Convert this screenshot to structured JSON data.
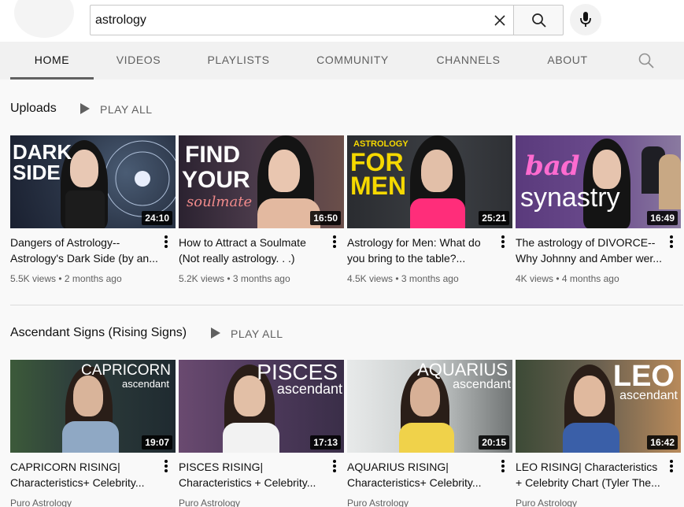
{
  "search": {
    "value": "astrology",
    "clear_icon": "close-icon",
    "search_icon": "search-icon",
    "mic_icon": "mic-icon"
  },
  "tabs": [
    {
      "label": "HOME",
      "active": true
    },
    {
      "label": "VIDEOS"
    },
    {
      "label": "PLAYLISTS"
    },
    {
      "label": "COMMUNITY"
    },
    {
      "label": "CHANNELS"
    },
    {
      "label": "ABOUT"
    }
  ],
  "sections": [
    {
      "title": "Uploads",
      "play_all": "PLAY ALL",
      "videos": [
        {
          "thumb_text": [
            "DARK",
            "SIDE"
          ],
          "duration": "24:10",
          "title": "Dangers of Astrology--Astrology's Dark Side (by an...",
          "views": "5.5K views",
          "age": "2 months ago"
        },
        {
          "thumb_text": [
            "FIND",
            "YOUR",
            "soulmate"
          ],
          "duration": "16:50",
          "title": "How to Attract a Soulmate (Not really astrology. . .)",
          "views": "5.2K views",
          "age": "3 months ago"
        },
        {
          "thumb_text": [
            "ASTROLOGY",
            "FOR",
            "MEN"
          ],
          "duration": "25:21",
          "title": "Astrology for Men: What do you bring to the table?...",
          "views": "4.5K views",
          "age": "3 months ago"
        },
        {
          "thumb_text": [
            "bad",
            "synastry"
          ],
          "duration": "16:49",
          "title": "The astrology of DIVORCE--Why Johnny and Amber wer...",
          "views": "4K views",
          "age": "4 months ago"
        }
      ]
    },
    {
      "title": "Ascendant Signs (Rising Signs)",
      "play_all": "PLAY ALL",
      "videos": [
        {
          "thumb_text": [
            "CAPRICORN",
            "ascendant"
          ],
          "duration": "19:07",
          "title": "CAPRICORN RISING| Characteristics+ Celebrity...",
          "channel": "Puro Astrology"
        },
        {
          "thumb_text": [
            "PISCES",
            "ascendant"
          ],
          "duration": "17:13",
          "title": "PISCES RISING| Characteristics + Celebrity...",
          "channel": "Puro Astrology"
        },
        {
          "thumb_text": [
            "AQUARIUS",
            "ascendant"
          ],
          "duration": "20:15",
          "title": "AQUARIUS RISING| Characteristics+ Celebrity...",
          "channel": "Puro Astrology"
        },
        {
          "thumb_text": [
            "LEO",
            "ascendant"
          ],
          "duration": "16:42",
          "title": "LEO RISING| Characteristics + Celebrity Chart (Tyler The...",
          "channel": "Puro Astrology"
        }
      ]
    }
  ]
}
